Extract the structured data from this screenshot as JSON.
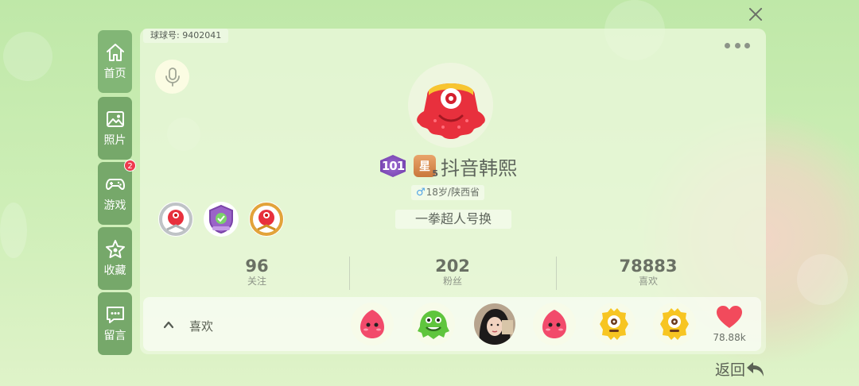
{
  "profile": {
    "id_label": "球球号: 9402041",
    "level": "101",
    "star_rank": "5",
    "nickname": "抖音韩熙",
    "gender_symbol": "♂",
    "age_location": "18岁/陕西省",
    "signature": "一拳超人号换"
  },
  "nav": {
    "items": [
      {
        "label": "首页",
        "icon": "home-icon",
        "active": true
      },
      {
        "label": "照片",
        "icon": "photo-icon"
      },
      {
        "label": "游戏",
        "icon": "gamepad-icon",
        "badge": "2"
      },
      {
        "label": "收藏",
        "icon": "star-icon"
      },
      {
        "label": "留言",
        "icon": "message-icon"
      }
    ]
  },
  "stats": [
    {
      "value": "96",
      "label": "关注"
    },
    {
      "value": "202",
      "label": "粉丝"
    },
    {
      "value": "78883",
      "label": "喜欢"
    }
  ],
  "likes": {
    "label": "喜欢",
    "count": "78.88k",
    "avatars": [
      "pink-blob",
      "green-monster",
      "photo-girl",
      "pink-blob",
      "yellow-cyclops",
      "yellow-cyclops"
    ]
  },
  "back": {
    "label": "返回"
  },
  "colors": {
    "nav_bg": "#76a86a",
    "accent_red": "#ef3b4e",
    "gender_blue": "#4fa3e6"
  }
}
